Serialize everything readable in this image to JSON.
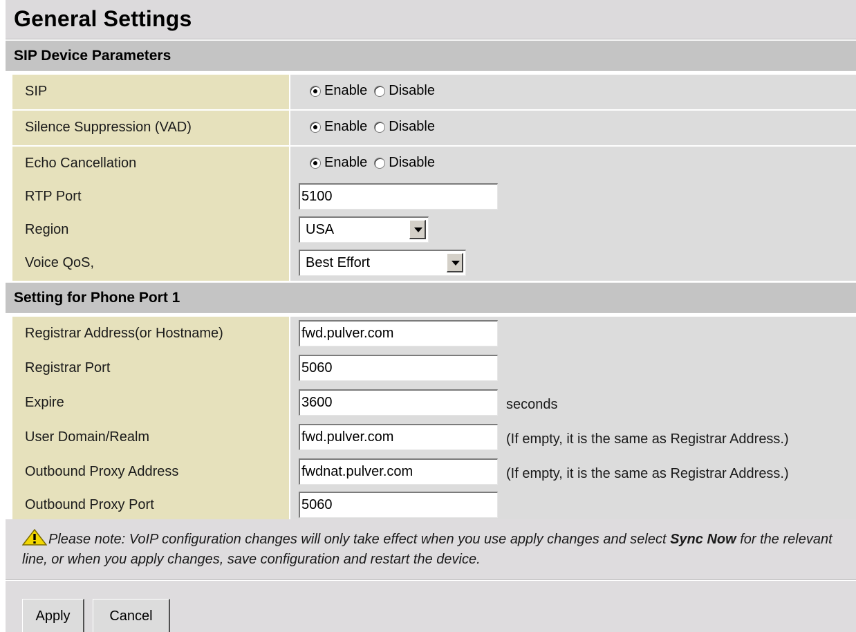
{
  "title": "General Settings",
  "sections": {
    "device": {
      "heading": "SIP Device Parameters"
    },
    "phone": {
      "heading": "Setting for Phone Port 1"
    }
  },
  "radio_options": {
    "enable": "Enable",
    "disable": "Disable"
  },
  "device_params": {
    "sip": {
      "label": "SIP",
      "selected": "Enable"
    },
    "vad": {
      "label": "Silence Suppression (VAD)",
      "selected": "Enable"
    },
    "echo": {
      "label": "Echo Cancellation",
      "selected": "Enable"
    },
    "rtp_port": {
      "label": "RTP Port",
      "value": "5100"
    },
    "region": {
      "label": "Region",
      "value": "USA"
    },
    "voice_qos": {
      "label": "Voice QoS,",
      "value": "Best Effort"
    }
  },
  "phone_port": {
    "registrar_address": {
      "label": "Registrar Address(or Hostname)",
      "value": "fwd.pulver.com"
    },
    "registrar_port": {
      "label": "Registrar Port",
      "value": "5060"
    },
    "expire": {
      "label": "Expire",
      "value": "3600",
      "suffix": "seconds"
    },
    "user_domain": {
      "label": "User Domain/Realm",
      "value": "fwd.pulver.com",
      "suffix": "(If empty, it is the same as Registrar Address.)"
    },
    "outbound_proxy_address": {
      "label": "Outbound Proxy Address",
      "value": "fwdnat.pulver.com",
      "suffix": "(If empty, it is the same as Registrar Address.)"
    },
    "outbound_proxy_port": {
      "label": "Outbound Proxy Port",
      "value": "5060"
    }
  },
  "note": {
    "icon": "warning-icon",
    "part1": "Please note: VoIP configuration changes will only take effect when you use apply changes and select ",
    "bold": "Sync Now",
    "part2": " for the relevant line, or when you apply changes, save configuration and restart the device."
  },
  "buttons": {
    "apply": "Apply",
    "cancel": "Cancel"
  }
}
